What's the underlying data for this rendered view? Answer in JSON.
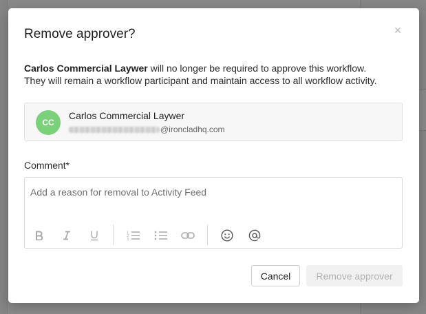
{
  "modal": {
    "title": "Remove approver?",
    "close_symbol": "×",
    "message_name": "Carlos Commercial Laywer",
    "message_line1_rest": " will no longer be required to approve this workflow.",
    "message_line2": "They will remain a workflow participant and maintain access to all workflow activity."
  },
  "user": {
    "initials": "CC",
    "name": "Carlos Commercial Laywer",
    "email_domain": "@ironcladhq.com",
    "avatar_color": "#7ad17a"
  },
  "comment": {
    "label": "Comment*",
    "placeholder": "Add a reason for removal to Activity Feed",
    "value": ""
  },
  "toolbar": {
    "icons": [
      "bold-icon",
      "italic-icon",
      "underline-icon",
      "ordered-list-icon",
      "bullet-list-icon",
      "link-icon",
      "emoji-icon",
      "mention-icon"
    ]
  },
  "actions": {
    "cancel_label": "Cancel",
    "remove_label": "Remove approver"
  }
}
